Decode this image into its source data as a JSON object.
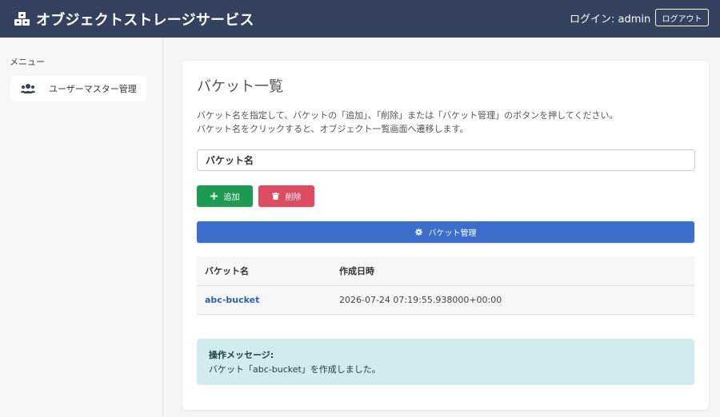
{
  "header": {
    "title": "オブジェクトストレージサービス",
    "login_label": "ログイン: admin",
    "logout_label": "ログアウト",
    "bg_color": "#344260"
  },
  "sidebar": {
    "heading": "メニュー",
    "items": [
      {
        "label": "ユーザーマスター管理",
        "icon": "users-icon"
      }
    ]
  },
  "main": {
    "title": "バケット一覧",
    "description_line1": "バケット名を指定して、バケットの「追加」、「削除」または「バケット管理」のボタンを押してください。",
    "description_line2": "バケット名をクリックすると、オブジェクト一覧画面へ遷移します。",
    "input": {
      "placeholder": "バケット名",
      "value": ""
    },
    "buttons": {
      "add": "追加",
      "delete": "削除",
      "manage": "バケット管理"
    },
    "table": {
      "columns": [
        "バケット名",
        "作成日時"
      ],
      "rows": [
        {
          "name": "abc-bucket",
          "created": "2026-07-24 07:19:55.938000+00:00"
        }
      ]
    },
    "alert": {
      "title": "操作メッセージ:",
      "message": "バケット「abc-bucket」を作成しました。"
    }
  },
  "colors": {
    "add": "#1d9a53",
    "delete": "#de4c61",
    "manage": "#3b6fcb",
    "link": "#2e5fb7",
    "alert_bg": "#d2ebee"
  }
}
